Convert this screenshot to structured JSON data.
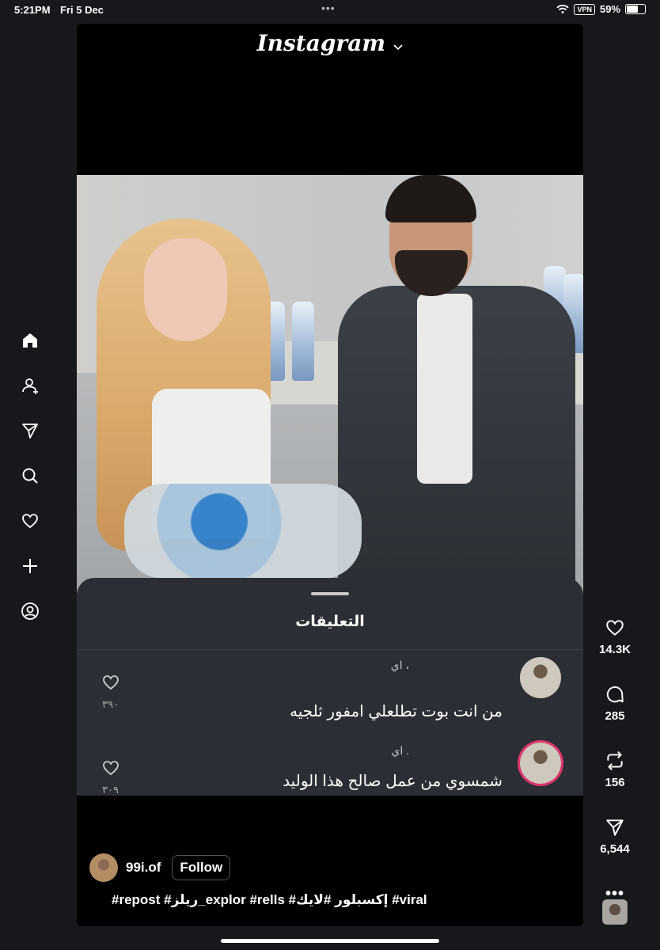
{
  "status_bar": {
    "time": "5:21PM",
    "date": "Fri 5 Dec",
    "battery": "59%",
    "vpn": "VPN"
  },
  "header": {
    "logo": "Instagram"
  },
  "sidebar": {
    "items": [
      {
        "icon": "home-icon"
      },
      {
        "icon": "people-icon"
      },
      {
        "icon": "send-icon"
      },
      {
        "icon": "search-icon"
      },
      {
        "icon": "heart-icon"
      },
      {
        "icon": "plus-icon"
      },
      {
        "icon": "profile-icon"
      }
    ]
  },
  "comments_sheet": {
    "title": "التعليقات",
    "comments": [
      {
        "name": "، اي",
        "text": "من انت بوت تطلعلي امفور ثلجيه",
        "likes": "٣٩٠"
      },
      {
        "name": ". اي",
        "text": "شمسوي من عمل صالح هذا الوليد",
        "likes": "٣٠٩"
      }
    ]
  },
  "actions": {
    "likes": "14.3K",
    "comments": "285",
    "reposts": "156",
    "shares": "6,544"
  },
  "author": {
    "username": "99i.of",
    "follow_label": "Follow"
  },
  "caption": "#repost #ريلز_explor #rells #إكسبلور #لايك #viral"
}
